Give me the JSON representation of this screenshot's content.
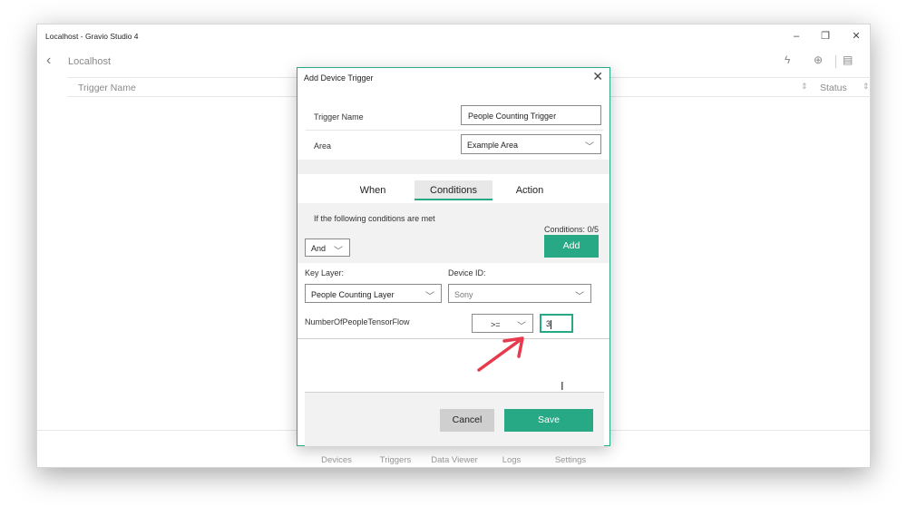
{
  "window": {
    "title": "Localhost - Gravio Studio 4",
    "controls": {
      "minimize": "–",
      "restore": "❐",
      "close": "✕"
    }
  },
  "navbar": {
    "back_icon": "chevron-left-icon",
    "title": "Localhost",
    "tool_icons": [
      "add-trigger-icon",
      "add-search-icon",
      "layout-icon"
    ]
  },
  "list_header": {
    "trigger_name": "Trigger Name",
    "status": "Status"
  },
  "bottom_nav": {
    "items": [
      "Devices",
      "Triggers",
      "Data Viewer",
      "Logs",
      "Settings"
    ]
  },
  "dialog": {
    "title": "Add Device Trigger",
    "close_icon": "✕",
    "trigger_name_label": "Trigger Name",
    "trigger_name_value": "People Counting Trigger",
    "area_label": "Area",
    "area_value": "Example Area",
    "tabs": {
      "when": "When",
      "conditions": "Conditions",
      "action": "Action"
    },
    "active_tab": "Conditions",
    "conditions_text": "If the following conditions are met",
    "conditions_count": "Conditions: 0/5",
    "add_label": "Add",
    "logic_value": "And",
    "key_layer_label": "Key Layer:",
    "key_layer_value": "People Counting Layer",
    "device_id_label": "Device ID:",
    "device_id_value": "Sony",
    "property_label": "NumberOfPeopleTensorFlow",
    "operator_value": ">=",
    "threshold_value": "3",
    "cancel_label": "Cancel",
    "save_label": "Save"
  },
  "colors": {
    "accent": "#26a984",
    "annotation_arrow": "#e8394d"
  }
}
